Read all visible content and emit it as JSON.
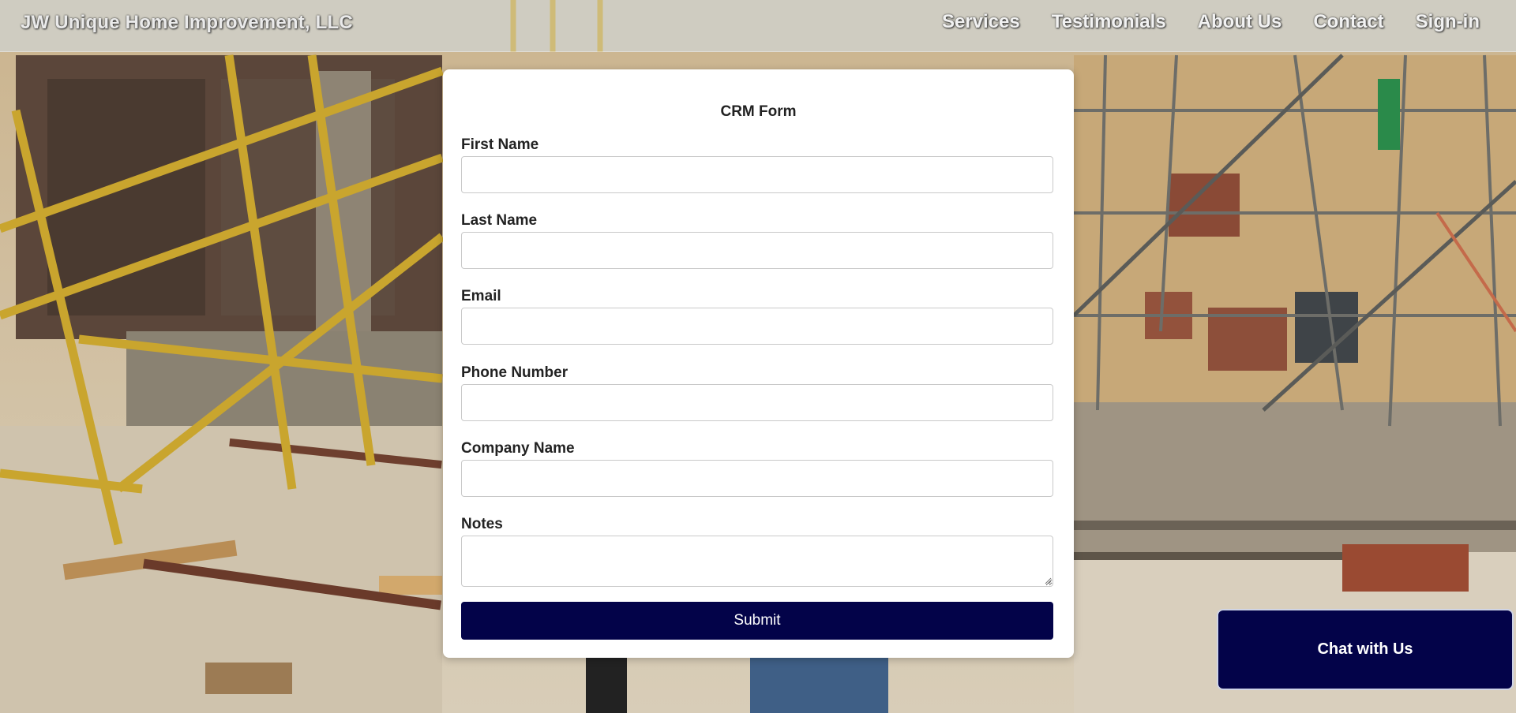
{
  "header": {
    "brand": "JW Unique Home Improvement, LLC",
    "nav": [
      {
        "label": "Services"
      },
      {
        "label": "Testimonials"
      },
      {
        "label": "About Us"
      },
      {
        "label": "Contact"
      },
      {
        "label": "Sign-in"
      }
    ]
  },
  "form": {
    "title": "CRM Form",
    "fields": [
      {
        "label": "First Name",
        "value": ""
      },
      {
        "label": "Last Name",
        "value": ""
      },
      {
        "label": "Email",
        "value": ""
      },
      {
        "label": "Phone Number",
        "value": ""
      },
      {
        "label": "Company Name",
        "value": ""
      },
      {
        "label": "Notes",
        "value": ""
      }
    ],
    "submit_label": "Submit"
  },
  "chat": {
    "label": "Chat with Us"
  },
  "colors": {
    "accent": "#030349",
    "card": "#ffffff"
  },
  "background": {
    "icon": "construction-site-photo"
  }
}
